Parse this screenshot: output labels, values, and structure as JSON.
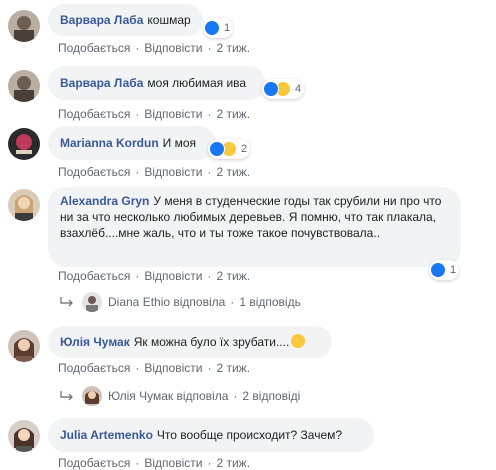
{
  "labels": {
    "like": "Подобається",
    "reply": "Відповісти",
    "sep": "·"
  },
  "comments": [
    {
      "author": "Варвара Лаба",
      "text": "кошмар",
      "time": "2 тиж.",
      "reaction_count": "1"
    },
    {
      "author": "Варвара Лаба",
      "text": "моя любимая ива",
      "time": "2 тиж.",
      "reaction_count": "4"
    },
    {
      "author": "Marianna Kordun",
      "text": "И моя",
      "time": "2 тиж.",
      "reaction_count": "2"
    },
    {
      "author": "Alexandra Gryn",
      "text": "У меня в студенческие годы так срубили ни про что ни за что несколько любимых деревьев. Я помню, что так плакала, взахлёб....мне жаль, что и ты тоже такое почувствовала..",
      "time": "2 тиж.",
      "reaction_count": "1"
    },
    {
      "author": "Юлія Чумак",
      "text": "Як можна було їх зрубати....",
      "time": "2 тиж."
    },
    {
      "author": "Julia Artemenko",
      "text": "Что вообще происходит? Зачем?",
      "time": "2 тиж."
    }
  ],
  "replies": [
    {
      "by": "Diana Ethio",
      "action": "відповіла",
      "count": "1 відповідь"
    },
    {
      "by": "Юлія Чумак",
      "action": "відповіла",
      "count": "2 відповіді"
    }
  ],
  "colors": {
    "author": "#385898",
    "bubble": "#f2f3f5",
    "meta": "#606770",
    "like": "#1877f2",
    "sad": "#f7c83c"
  }
}
